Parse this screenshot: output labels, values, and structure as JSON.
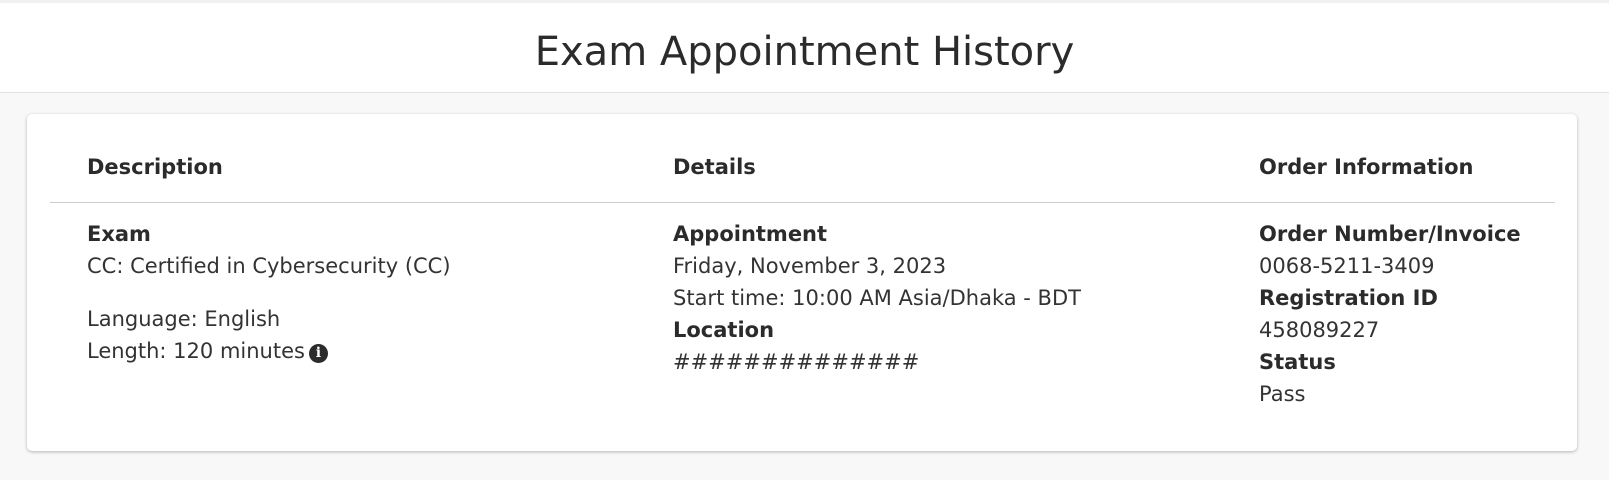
{
  "page": {
    "title": "Exam Appointment History"
  },
  "table": {
    "headers": {
      "description": "Description",
      "details": "Details",
      "order": "Order Information"
    },
    "row": {
      "description": {
        "exam_label": "Exam",
        "exam_name": "CC: Certified in Cybersecurity (CC)",
        "language": "Language: English",
        "length": "Length: 120 minutes",
        "length_icon": "info-icon"
      },
      "details": {
        "appointment_label": "Appointment",
        "date": "Friday, November 3, 2023",
        "start_time": "Start time: 10:00 AM Asia/Dhaka - BDT",
        "location_label": "Location",
        "location": "##############"
      },
      "order": {
        "order_number_label": "Order Number/Invoice",
        "order_number": "0068-5211-3409",
        "registration_label": "Registration ID",
        "registration_id": "458089227",
        "status_label": "Status",
        "status": "Pass"
      }
    }
  }
}
